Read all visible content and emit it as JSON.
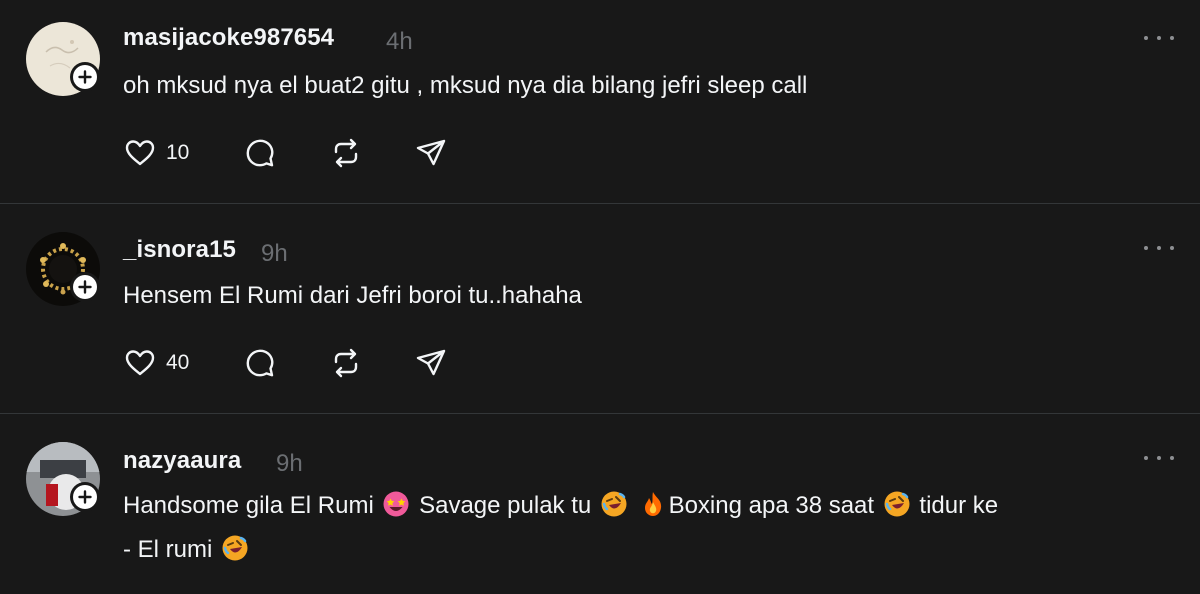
{
  "posts": [
    {
      "username": "masijacoke987654",
      "time": "4h",
      "text": "oh mksud nya el buat2 gitu , mksud nya dia bilang jefri sleep call",
      "likes": "10"
    },
    {
      "username": "_isnora15",
      "time": "9h",
      "text": "Hensem El Rumi dari Jefri boroi tu..hahaha",
      "likes": "40"
    },
    {
      "username": "nazyaaura",
      "time": "9h",
      "text_parts": [
        "Handsome gila El Rumi ",
        " Savage pulak tu ",
        " ",
        "Boxing apa 38 saat ",
        " tidur ke",
        "- El rumi "
      ]
    }
  ],
  "icons": {
    "like": "heart-icon",
    "reply": "comment-icon",
    "repost": "repost-icon",
    "share": "send-icon",
    "more": "more-icon",
    "follow": "plus-icon"
  }
}
